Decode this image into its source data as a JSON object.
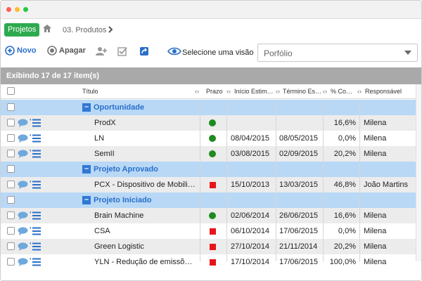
{
  "breadcrumb": {
    "projects_button": "Projetos",
    "current": "03. Produtos"
  },
  "toolbar": {
    "new_label": "Novo",
    "delete_label": "Apagar",
    "view_label": "Selecione uma visão"
  },
  "view_select": {
    "value": "Porfólio"
  },
  "grid": {
    "summary": "Exibindo 17 de 17 item(s)",
    "columns": {
      "title": "Título",
      "prazo": "Prazo",
      "inicio": "Início Estim…",
      "termino": "Término Es…",
      "pct": "% Co…",
      "resp": "Responsável"
    },
    "groups": [
      {
        "label": "Oportunidade"
      },
      {
        "label": "Projeto Aprovado"
      },
      {
        "label": "Projeto Iniciado"
      }
    ],
    "rows": [
      {
        "title": "ProdX",
        "status": "green",
        "inicio": "",
        "termino": "",
        "pct": "16,6%",
        "resp": "Milena"
      },
      {
        "title": "LN",
        "status": "green",
        "inicio": "08/04/2015",
        "termino": "08/05/2015",
        "pct": "0,0%",
        "resp": "Milena"
      },
      {
        "title": "SemII",
        "status": "green",
        "inicio": "03/08/2015",
        "termino": "02/09/2015",
        "pct": "20,2%",
        "resp": "Milena"
      },
      {
        "title": "PCX - Dispositivo de Mobili…",
        "status": "red",
        "inicio": "15/10/2013",
        "termino": "13/03/2015",
        "pct": "46,8%",
        "resp": "João Martins"
      },
      {
        "title": "Brain Machine",
        "status": "green",
        "inicio": "02/06/2014",
        "termino": "26/06/2015",
        "pct": "16,6%",
        "resp": "Milena"
      },
      {
        "title": "CSA",
        "status": "red",
        "inicio": "06/10/2014",
        "termino": "17/06/2015",
        "pct": "0,0%",
        "resp": "Milena"
      },
      {
        "title": "Green Logistic",
        "status": "red",
        "inicio": "27/10/2014",
        "termino": "21/11/2014",
        "pct": "20,2%",
        "resp": "Milena"
      },
      {
        "title": "YLN - Redução de emissõ…",
        "status": "red",
        "inicio": "17/10/2014",
        "termino": "17/06/2015",
        "pct": "100,0%",
        "resp": "Milena"
      }
    ]
  },
  "colors": {
    "accent_green": "#2eaa4e",
    "accent_blue": "#2a6fc9",
    "group_bg": "#b8d8f6",
    "status_green": "#1f8a1f",
    "status_red": "#e8141a"
  }
}
